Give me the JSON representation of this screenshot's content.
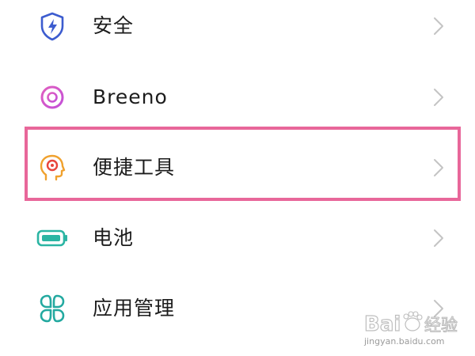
{
  "settings": {
    "items": [
      {
        "label": "安全",
        "icon": "shield-icon",
        "icon_color": "#3c5ccf"
      },
      {
        "label": "Breeno",
        "icon": "breeno-icon",
        "icon_color": "#d957c9"
      },
      {
        "label": "便捷工具",
        "icon": "head-target-icon",
        "icon_color": "#f0a12e",
        "highlighted": true
      },
      {
        "label": "电池",
        "icon": "battery-icon",
        "icon_color": "#2bb5a3"
      },
      {
        "label": "应用管理",
        "icon": "app-grid-icon",
        "icon_color": "#23a9a0"
      }
    ]
  },
  "highlight": {
    "color": "#e8679a"
  },
  "watermark": {
    "brand": "Baidu经验",
    "url": "jingyan.baidu.com"
  }
}
